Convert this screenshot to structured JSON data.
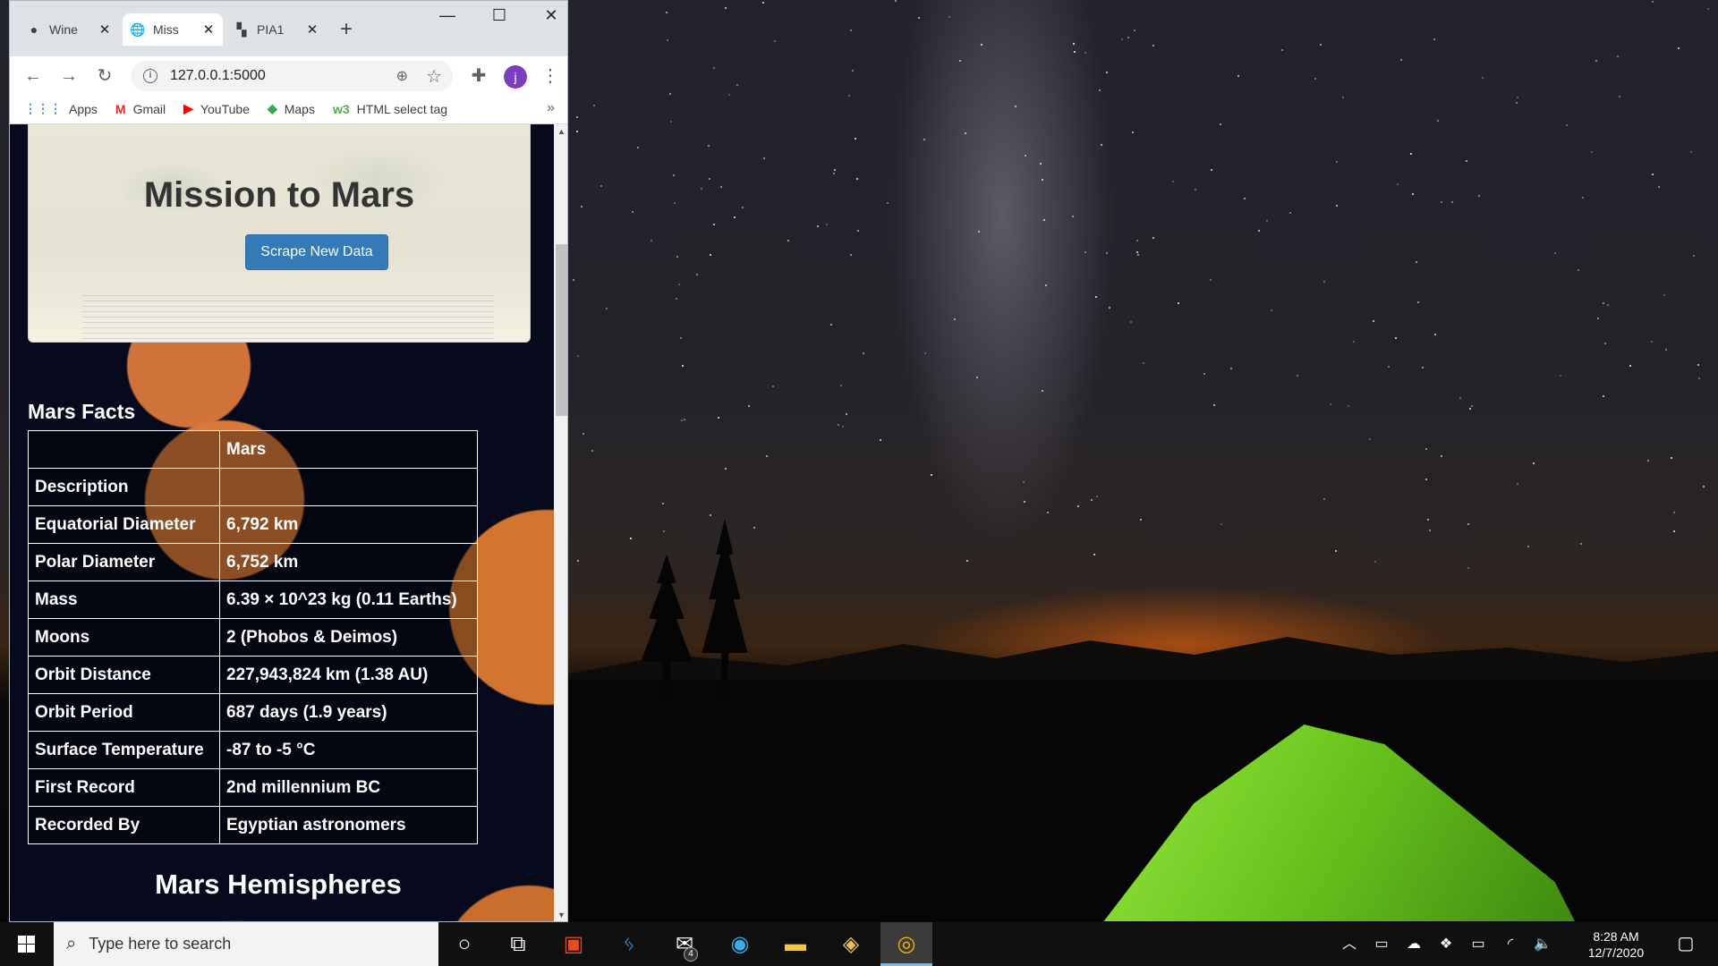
{
  "browser": {
    "tabs": [
      {
        "title": "Wine",
        "icon": "github-icon"
      },
      {
        "title": "Miss",
        "icon": "globe-icon"
      },
      {
        "title": "PIA1",
        "icon": "nasa-image-icon"
      }
    ],
    "new_tab": "+",
    "window_controls": {
      "minimize": "—",
      "maximize": "☐",
      "close": "✕"
    },
    "url": "127.0.0.1:5000",
    "avatar_letter": "j",
    "bookmarks": [
      {
        "label": "Apps",
        "icon": "apps-grid-icon"
      },
      {
        "label": "Gmail",
        "icon": "gmail-icon"
      },
      {
        "label": "YouTube",
        "icon": "youtube-icon"
      },
      {
        "label": "Maps",
        "icon": "maps-icon"
      },
      {
        "label": "HTML select tag",
        "icon": "w3schools-icon"
      }
    ],
    "bookmarks_more": "»"
  },
  "page": {
    "title": "Mission to Mars",
    "scrape_button": "Scrape New Data",
    "facts_heading": "Mars Facts",
    "facts_table": {
      "header": [
        "",
        "Mars"
      ],
      "rows": [
        [
          "Description",
          ""
        ],
        [
          "Equatorial Diameter",
          "6,792 km"
        ],
        [
          "Polar Diameter",
          "6,752 km"
        ],
        [
          "Mass",
          "6.39 × 10^23 kg (0.11 Earths)"
        ],
        [
          "Moons",
          "2 (Phobos & Deimos)"
        ],
        [
          "Orbit Distance",
          "227,943,824 km (1.38 AU)"
        ],
        [
          "Orbit Period",
          "687 days (1.9 years)"
        ],
        [
          "Surface Temperature",
          "-87 to -5 °C"
        ],
        [
          "First Record",
          "2nd millennium BC"
        ],
        [
          "Recorded By",
          "Egyptian astronomers"
        ]
      ]
    },
    "hemispheres_heading": "Mars Hemispheres"
  },
  "taskbar": {
    "search_placeholder": "Type here to search",
    "mail_badge": "4",
    "time": "8:28 AM",
    "date": "12/7/2020"
  },
  "colors": {
    "button_blue": "#337ab7",
    "page_background": "#070a1d",
    "mars_orange": "#d2743a",
    "tent_green": "#6cc81e"
  }
}
